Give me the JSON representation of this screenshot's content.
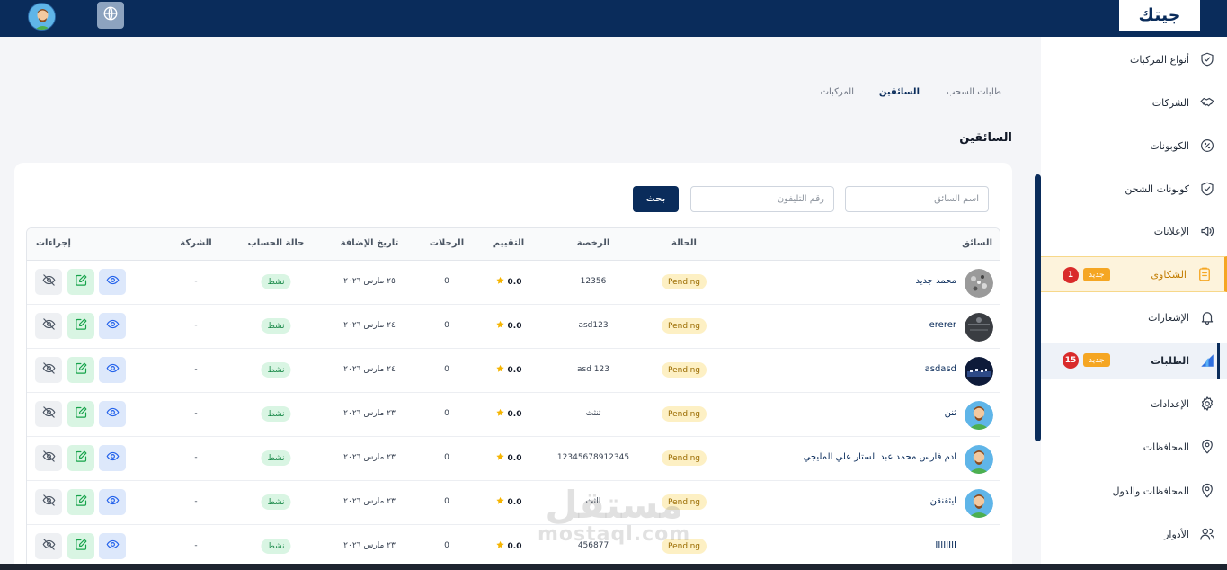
{
  "brand": {
    "logo_text": "جيتك",
    "accent": "#f5a623",
    "primary": "#0a2c5b"
  },
  "topbar": {
    "globe_icon": "globe-icon",
    "avatar": "user-avatar"
  },
  "sidebar": {
    "items": [
      {
        "label": "أنواع المركبات",
        "icon": "shield-check-icon"
      },
      {
        "label": "الشركات",
        "icon": "handshake-icon"
      },
      {
        "label": "الكوبونات",
        "icon": "percent-badge-icon"
      },
      {
        "label": "كوبونات الشحن",
        "icon": "shield-check-icon"
      },
      {
        "label": "الإعلانات",
        "icon": "megaphone-icon"
      },
      {
        "label": "الشكاوى",
        "icon": "clipboard-icon",
        "badge_new": "جديد",
        "badge_count": "1"
      },
      {
        "label": "الإشعارات",
        "icon": "bell-icon"
      },
      {
        "label": "الطلبات",
        "icon": "chart-icon",
        "badge_new": "جديد",
        "badge_count": "15"
      },
      {
        "label": "الإعدادات",
        "icon": "gear-icon"
      },
      {
        "label": "المحافظات",
        "icon": "map-pin-icon"
      },
      {
        "label": "المحافظات والدول",
        "icon": "map-pin-icon"
      },
      {
        "label": "الأدوار",
        "icon": "users-icon"
      }
    ]
  },
  "tabs": {
    "tow_requests": "طلبات السحب",
    "drivers": "السائقين",
    "vehicles": "المركبات"
  },
  "page_title": "السائقين",
  "filters": {
    "name_placeholder": "اسم السائق",
    "phone_placeholder": "رقم التليفون",
    "search_label": "بحث"
  },
  "table": {
    "headers": {
      "driver": "السائق",
      "status": "الحالة",
      "license": "الرخصة",
      "rating": "التقييم",
      "trips": "الرحلات",
      "added_date": "تاريخ الإضافة",
      "account_status": "حالة الحساب",
      "company": "الشركة",
      "actions": "إجراءات"
    },
    "rows": [
      {
        "name": "محمد جديد",
        "status": "Pending",
        "license": "12356",
        "rating": "0.0",
        "trips": "0",
        "date": "٢٥ مارس ٢٠٢٦",
        "account": "نشط",
        "company": "-",
        "avatar": "noise"
      },
      {
        "name": "ererer",
        "status": "Pending",
        "license": "asd123",
        "rating": "0.0",
        "trips": "0",
        "date": "٢٤ مارس ٢٠٢٦",
        "account": "نشط",
        "company": "-",
        "avatar": "dark"
      },
      {
        "name": "asdasd",
        "status": "Pending",
        "license": "asd 123",
        "rating": "0.0",
        "trips": "0",
        "date": "٢٤ مارس ٢٠٢٦",
        "account": "نشط",
        "company": "-",
        "avatar": "city"
      },
      {
        "name": "ثنن",
        "status": "Pending",
        "license": "ثنثث",
        "rating": "0.0",
        "trips": "0",
        "date": "٢٣ مارس ٢٠٢٦",
        "account": "نشط",
        "company": "-",
        "avatar": "person"
      },
      {
        "name": "ادم فارس محمد عبد الستار علي المليجي",
        "status": "Pending",
        "license": "12345678912345",
        "rating": "0.0",
        "trips": "0",
        "date": "٢٣ مارس ٢٠٢٦",
        "account": "نشط",
        "company": "-",
        "avatar": "person"
      },
      {
        "name": "ايثقنقن",
        "status": "Pending",
        "license": "الثث",
        "rating": "0.0",
        "trips": "0",
        "date": "٢٣ مارس ٢٠٢٦",
        "account": "نشط",
        "company": "-",
        "avatar": "person"
      },
      {
        "name": "IIIIIIII",
        "status": "Pending",
        "license": "456877",
        "rating": "0.0",
        "trips": "0",
        "date": "٢٣ مارس ٢٠٢٦",
        "account": "نشط",
        "company": "-",
        "avatar": "none"
      }
    ]
  },
  "watermark": {
    "arabic": "مستقل",
    "latin": "mostaql.com"
  }
}
